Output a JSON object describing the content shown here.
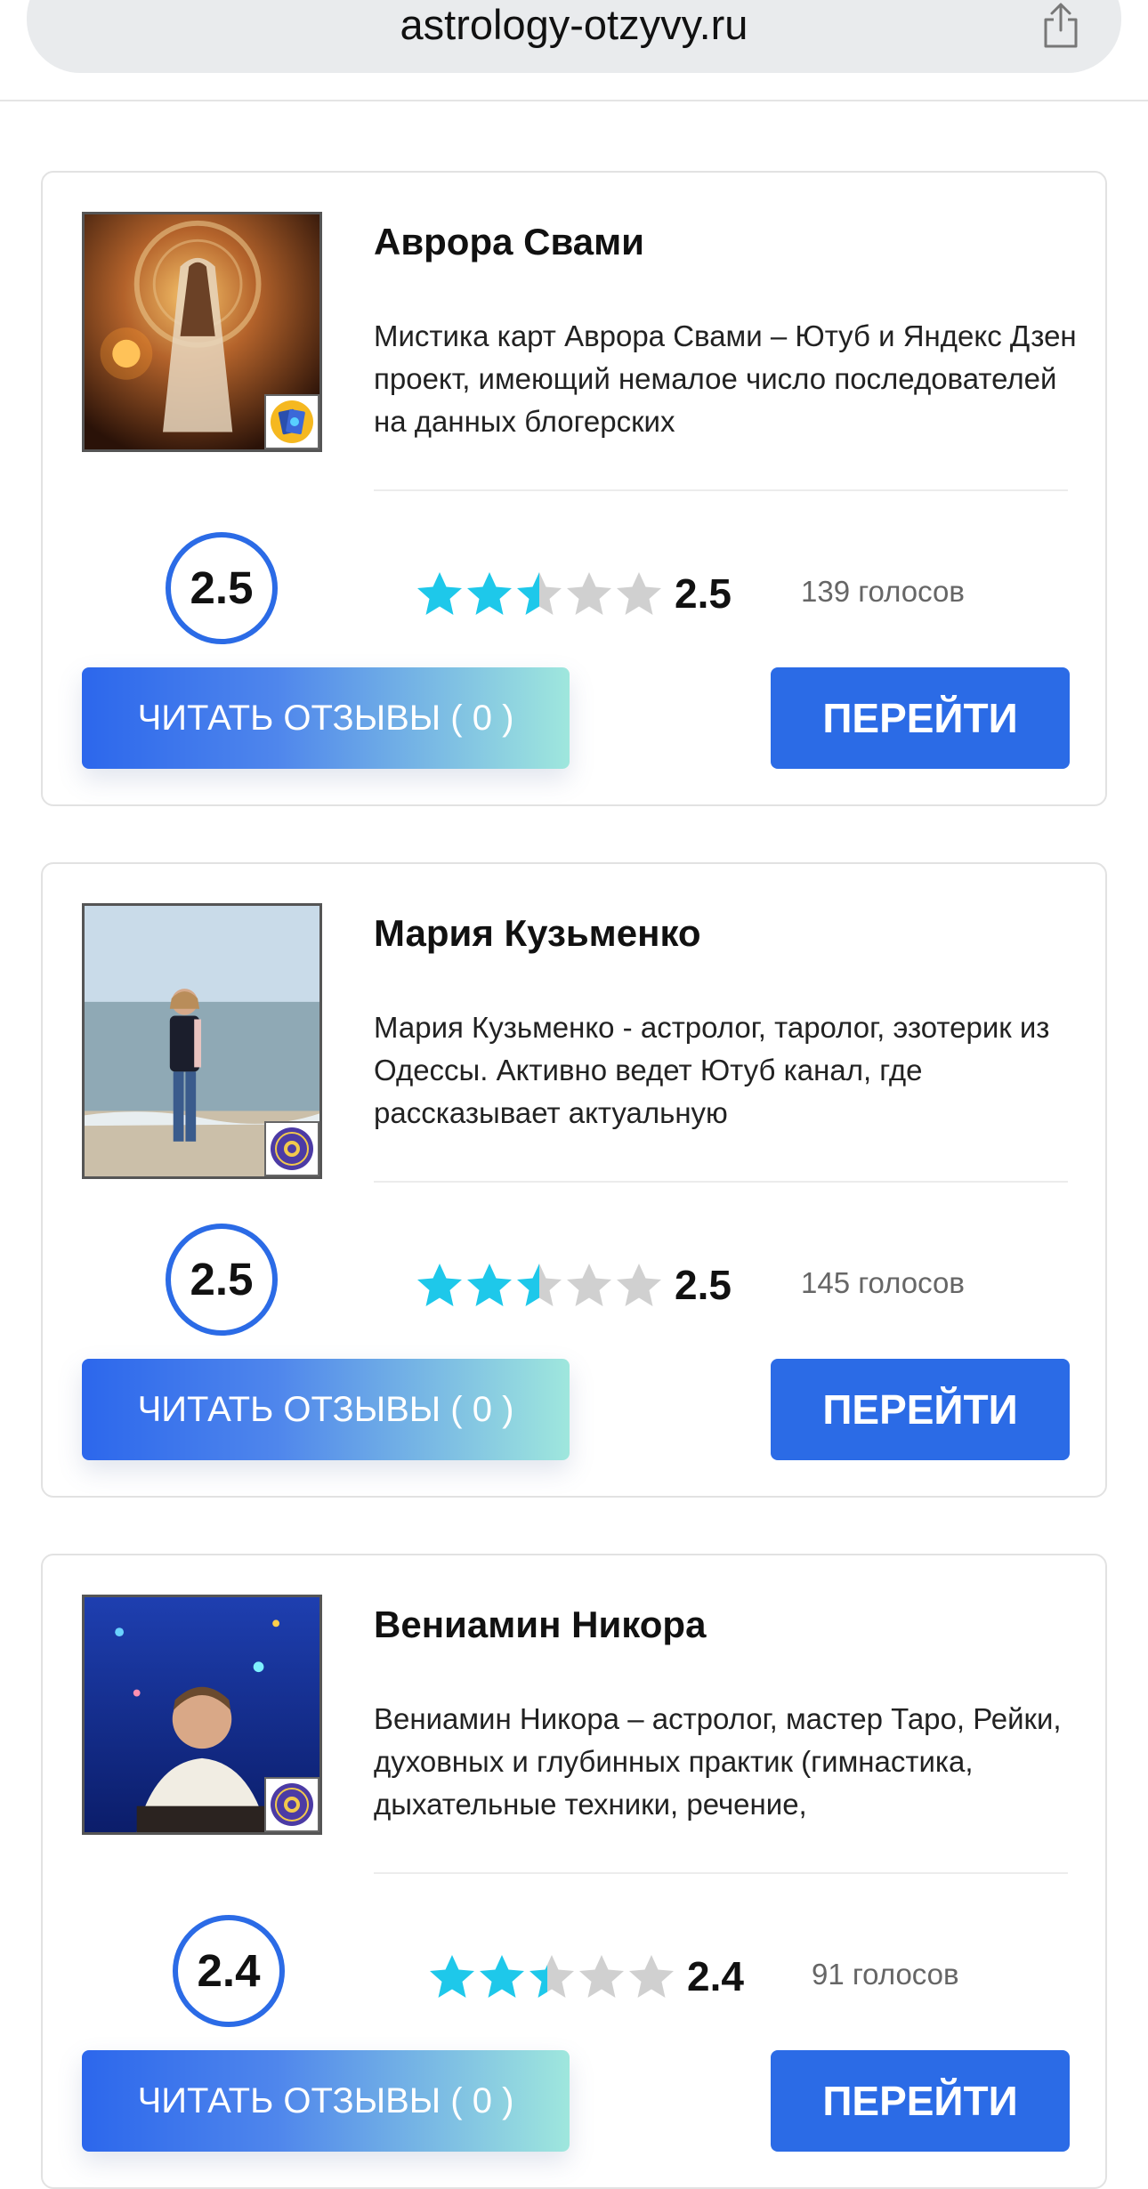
{
  "browser": {
    "url": "astrology-otzyvy.ru",
    "share_icon": "share-icon"
  },
  "colors": {
    "accent": "#2b6be6",
    "star_filled": "#1ec8ea",
    "star_empty": "#d0d0d0"
  },
  "cards": [
    {
      "name": "Аврора Свами",
      "description": "Мистика карт Аврора Свами – Ютуб и Яндекс Дзен проект, имеющий немалое число последователей на данных блогерских",
      "score": "2.5",
      "rating": "2.5",
      "rating_value": 2.5,
      "votes": "139 голосов",
      "reviews_label": "ЧИТАТЬ ОТЗЫВЫ ( 0 )",
      "go_label": "ПЕРЕЙТИ",
      "badge_icon": "tarot-cards-icon"
    },
    {
      "name": "Мария Кузьменко",
      "description": "Мария Кузьменко - астролог, таролог, эзотерик из Одессы. Активно ведет Ютуб канал, где рассказывает актуальную",
      "score": "2.5",
      "rating": "2.5",
      "rating_value": 2.5,
      "votes": "145 голосов",
      "reviews_label": "ЧИТАТЬ ОТЗЫВЫ ( 0 )",
      "go_label": "ПЕРЕЙТИ",
      "badge_icon": "zodiac-wheel-icon"
    },
    {
      "name": "Вениамин Никора",
      "description": "Вениамин Никора – астролог, мастер Таро, Рейки, духовных и глубинных практик (гимнастика, дыхательные техники, речение,",
      "score": "2.4",
      "rating": "2.4",
      "rating_value": 2.4,
      "votes": "91 голосов",
      "reviews_label": "ЧИТАТЬ ОТЗЫВЫ ( 0 )",
      "go_label": "ПЕРЕЙТИ",
      "badge_icon": "zodiac-wheel-icon"
    }
  ]
}
